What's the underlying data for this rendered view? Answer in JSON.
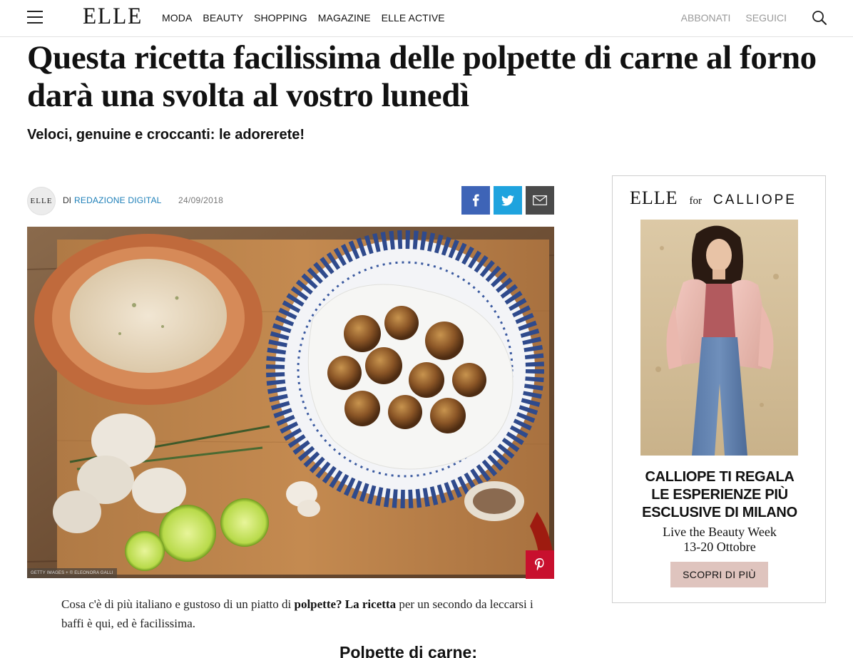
{
  "nav": {
    "logo": "ELLE",
    "links": [
      "MODA",
      "BEAUTY",
      "SHOPPING",
      "MAGAZINE",
      "ELLE ACTIVE"
    ],
    "right_links": [
      "ABBONATI",
      "SEGUICI"
    ],
    "menu_icon": "hamburger-icon",
    "search_icon": "search-icon"
  },
  "article": {
    "title": "Questa ricetta facilissima delle polpette di carne al forno darà una svolta al vostro lunedì",
    "subtitle": "Veloci, genuine e croccanti: le adorerete!",
    "byline_avatar_text": "ELLE",
    "byline_prefix": "DI",
    "author": "REDAZIONE DIGITAL",
    "date": "24/09/2018",
    "share": [
      {
        "name": "facebook",
        "icon": "facebook-icon",
        "color": "#3e64b7"
      },
      {
        "name": "twitter",
        "icon": "twitter-icon",
        "color": "#1fa3de"
      },
      {
        "name": "email",
        "icon": "mail-icon",
        "color": "#4a4a4a"
      }
    ],
    "image_credit": "GETTY IMAGES + © ELEONORA GALLI",
    "pin_icon": "pinterest-icon",
    "body_part1": "Cosa c'è di più italiano e gustoso di un piatto di ",
    "body_bold": "polpette? La ricetta",
    "body_part2": " per un secondo da leccarsi i baffi è qui, ed è facilissima.",
    "section_heading": "Polpette di carne:"
  },
  "ad": {
    "brand_elle": "ELLE",
    "brand_for": "for",
    "brand_partner": "CALLIOPE",
    "headline_lines": [
      "CALLIOPE TI REGALA",
      "LE ESPERIENZE PIÙ",
      "ESCLUSIVE DI MILANO"
    ],
    "sub_lines": [
      "Live the Beauty Week",
      "13-20 Ottobre"
    ],
    "cta": "SCOPRI DI PIÙ"
  },
  "colors": {
    "author_link": "#1d7fb8",
    "pinterest": "#c8102e",
    "cta_bg": "#dfc4be"
  }
}
